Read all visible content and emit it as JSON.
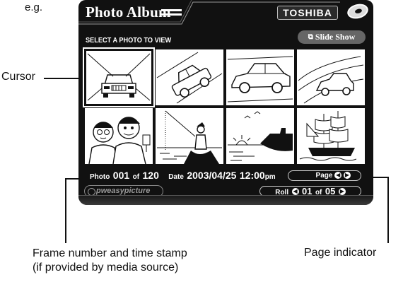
{
  "annotations": {
    "example": "e.g.",
    "cursor": "Cursor",
    "frame_line1": "Frame number and time stamp",
    "frame_line2": "(if provided by media source)",
    "page_indicator": "Page indicator"
  },
  "app": {
    "title": "Photo Album",
    "brand": "TOSHIBA",
    "instruction": "SELECT A PHOTO TO VIEW",
    "slideshow_label": "Slide Show",
    "logo": "pweasypicture"
  },
  "photos": [
    {
      "subject": "car-front",
      "selected": true
    },
    {
      "subject": "car-tilted",
      "selected": false
    },
    {
      "subject": "car-road",
      "selected": false
    },
    {
      "subject": "car-curve",
      "selected": false
    },
    {
      "subject": "two-men",
      "selected": false
    },
    {
      "subject": "fisherman",
      "selected": false
    },
    {
      "subject": "ship-sunset",
      "selected": false
    },
    {
      "subject": "sailing-ship",
      "selected": false
    }
  ],
  "info": {
    "photo_label": "Photo",
    "photo_number": "001",
    "of_label": "of",
    "photo_total": "120",
    "date_label": "Date",
    "date": "2003/04/25",
    "time": "12:00",
    "ampm": "pm"
  },
  "page": {
    "label": "Page"
  },
  "roll": {
    "label": "Roll",
    "current": "01",
    "of_label": "of",
    "total": "05"
  },
  "icons": {
    "prev": "◀",
    "next": "▶",
    "slideshow": "⧉"
  }
}
